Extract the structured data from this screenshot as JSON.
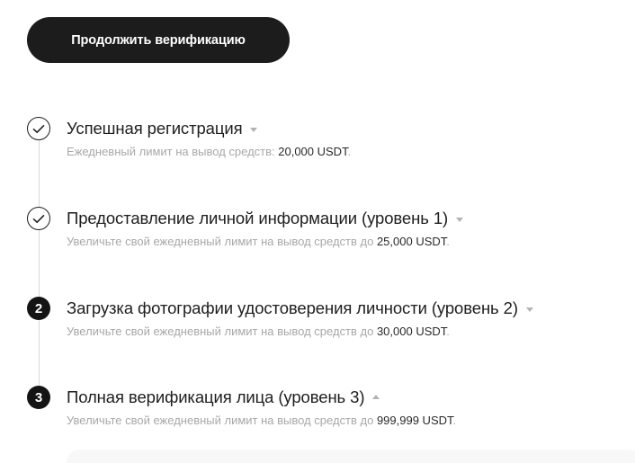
{
  "cta": {
    "label": "Продолжить верификацию"
  },
  "steps": [
    {
      "status": "done",
      "icon": "check-icon",
      "title": "Успешная регистрация",
      "caret": "down",
      "text": "Ежедневный лимит на вывод средств: ",
      "amount": "20,000 USDT",
      "suffix": "."
    },
    {
      "status": "done",
      "icon": "check-icon",
      "title": "Предоставление личной информации (уровень 1)",
      "caret": "down",
      "text": "Увеличьте свой ежедневный лимит на вывод средств до ",
      "amount": "25,000 USDT",
      "suffix": "."
    },
    {
      "status": "pending",
      "number": "2",
      "title": "Загрузка фотографии удостоверения личности (уровень 2)",
      "caret": "down",
      "text": "Увеличьте свой ежедневный лимит на вывод средств до ",
      "amount": "30,000 USDT",
      "suffix": "."
    },
    {
      "status": "pending",
      "number": "3",
      "title": "Полная верификация лица (уровень 3)",
      "caret": "up",
      "text": "Увеличьте свой ежедневный лимит на вывод средств до ",
      "amount": "999,999 USDT",
      "suffix": "."
    }
  ],
  "colors": {
    "primary_button": "#1c1c1c",
    "muted_text": "#a8a8a8",
    "timeline": "#d9d9d9"
  }
}
